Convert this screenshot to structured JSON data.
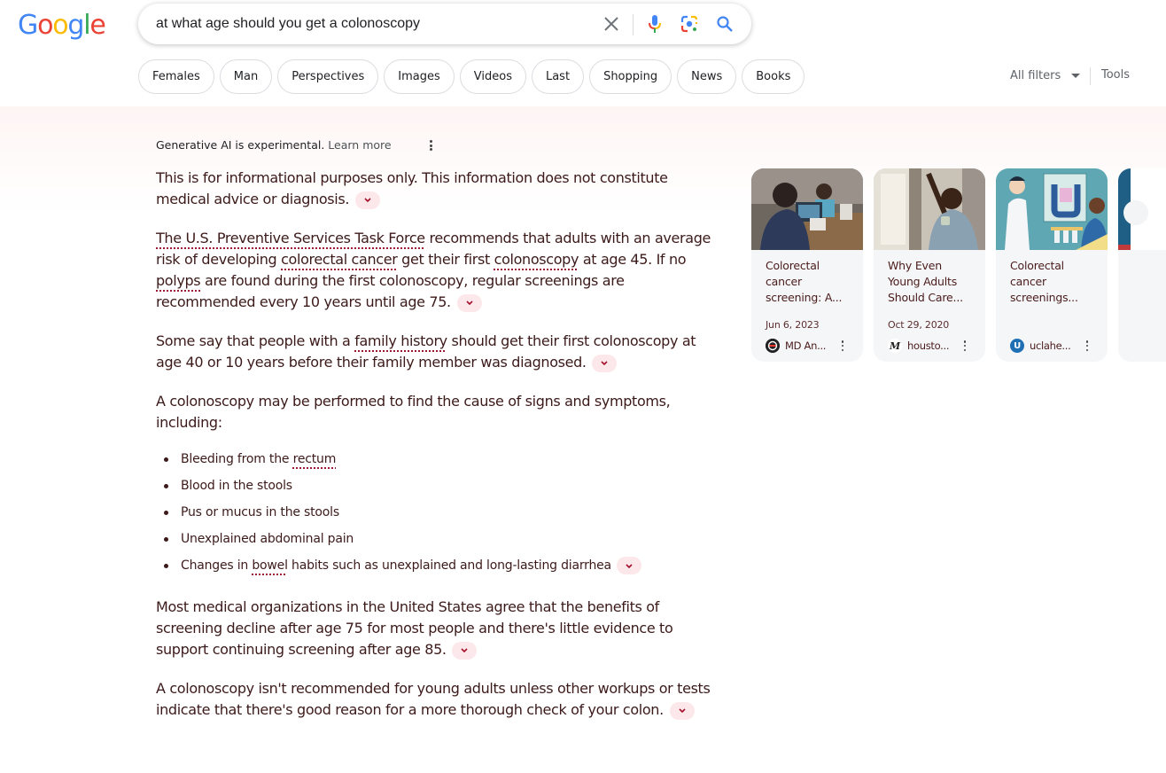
{
  "header": {
    "logo_letters": [
      {
        "ch": "G",
        "color": "#4285F4"
      },
      {
        "ch": "o",
        "color": "#EA4335"
      },
      {
        "ch": "o",
        "color": "#FBBC05"
      },
      {
        "ch": "g",
        "color": "#4285F4"
      },
      {
        "ch": "l",
        "color": "#34A853"
      },
      {
        "ch": "e",
        "color": "#EA4335"
      }
    ],
    "search_query": "at what age should you get a colonoscopy",
    "icons": [
      "clear-icon",
      "mic-icon",
      "lens-icon",
      "search-icon"
    ]
  },
  "chips": [
    {
      "label": "Females"
    },
    {
      "label": "Man"
    },
    {
      "label": "Perspectives"
    },
    {
      "label": "Images"
    },
    {
      "label": "Videos"
    },
    {
      "label": "Last"
    },
    {
      "label": "Shopping"
    },
    {
      "label": "News"
    },
    {
      "label": "Books"
    }
  ],
  "filters": {
    "all_filters_label": "All filters",
    "tools_label": "Tools"
  },
  "ai_overview": {
    "notice": "Generative AI is experimental.",
    "learn_more": "Learn more",
    "p1": "This is for informational purposes only. This information does not constitute medical advice or diagnosis.",
    "p2": {
      "t1": "The U.S. Preventive Services Task Force",
      "t2": " recommends that adults with an average risk of developing ",
      "t3": "colorectal cancer",
      "t4": " get their first ",
      "t5": "colonoscopy",
      "t6": " at age 45. If no ",
      "t7": "polyps",
      "t8": " are found during the first colonoscopy, regular screenings are recommended every 10 years until age 75."
    },
    "p3": {
      "t1": "Some say that people with a ",
      "t2": "family history",
      "t3": " should get their first colonoscopy at age 40 or 10 years before their family member was diagnosed."
    },
    "p4": "A colonoscopy may be performed to find the cause of signs and symptoms, including:",
    "symptoms": {
      "s1a": "Bleeding from the ",
      "s1b": "rectum",
      "s2": "Blood in the stools",
      "s3": "Pus or mucus in the stools",
      "s4": "Unexplained abdominal pain",
      "s5a": "Changes in ",
      "s5b": "bowel",
      "s5c": " habits such as unexplained and long-lasting diarrhea"
    },
    "p5": "Most medical organizations in the United States agree that the benefits of screening decline after age 75 for most people and there's little evidence to support continuing screening after age 85.",
    "p6": "A colonoscopy isn't recommended for young adults unless other workups or tests indicate that there's good reason for a more thorough check of your colon."
  },
  "source_cards": [
    {
      "title": "Colorectal cancer screening: A...",
      "date": "Jun 6, 2023",
      "source": "MD An...",
      "favicon": "md-anderson-icon",
      "favicon_color": "#222222"
    },
    {
      "title": "Why Even Young Adults Should Care...",
      "date": "Oct 29, 2020",
      "source": "housto...",
      "favicon": "houston-methodist-icon",
      "favicon_color": "#ffffff"
    },
    {
      "title": "Colorectal cancer screenings...",
      "date": "",
      "source": "uclahe...",
      "favicon": "ucla-health-icon",
      "favicon_color": "#1f6fb5"
    }
  ],
  "colors": {
    "accent_underline": "#9b1a32",
    "expand_bg": "#fce8ea",
    "ai_text": "#3c1a1a"
  }
}
